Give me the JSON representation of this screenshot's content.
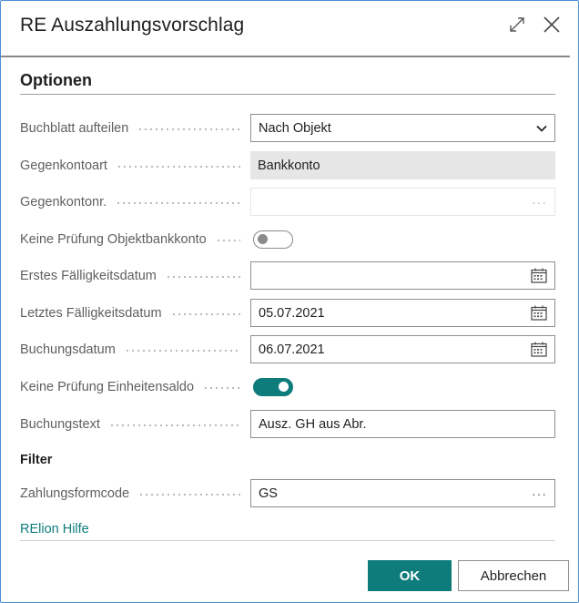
{
  "dialog": {
    "title": "RE Auszahlungsvorschlag",
    "icons": {
      "expand": "expand-icon",
      "close": "close-icon"
    }
  },
  "options": {
    "heading": "Optionen",
    "fields": {
      "buchblatt": {
        "label": "Buchblatt aufteilen",
        "value": "Nach Objekt"
      },
      "gegenkontoart": {
        "label": "Gegenkontoart",
        "value": "Bankkonto"
      },
      "gegenkontonr": {
        "label": "Gegenkontonr.",
        "value": "",
        "lookup": "···"
      },
      "keine_pruefung_objektbankkonto": {
        "label": "Keine Prüfung Objektbankkonto",
        "on": false
      },
      "erstes_faelligkeitsdatum": {
        "label": "Erstes Fälligkeitsdatum",
        "value": ""
      },
      "letztes_faelligkeitsdatum": {
        "label": "Letztes Fälligkeitsdatum",
        "value": "05.07.2021"
      },
      "buchungsdatum": {
        "label": "Buchungsdatum",
        "value": "06.07.2021"
      },
      "keine_pruefung_einheitensaldo": {
        "label": "Keine Prüfung Einheitensaldo",
        "on": true
      },
      "buchungstext": {
        "label": "Buchungstext",
        "value": "Ausz. GH aus Abr."
      }
    }
  },
  "filter": {
    "heading": "Filter",
    "fields": {
      "zahlungsformcode": {
        "label": "Zahlungsformcode",
        "value": "GS",
        "lookup": "···"
      }
    }
  },
  "help_link": "RElion Hilfe",
  "buttons": {
    "ok": "OK",
    "cancel": "Abbrechen"
  },
  "colors": {
    "accent": "#0f7c7c",
    "border": "#4a8fd6",
    "readonly_bg": "#e6e6e6"
  }
}
